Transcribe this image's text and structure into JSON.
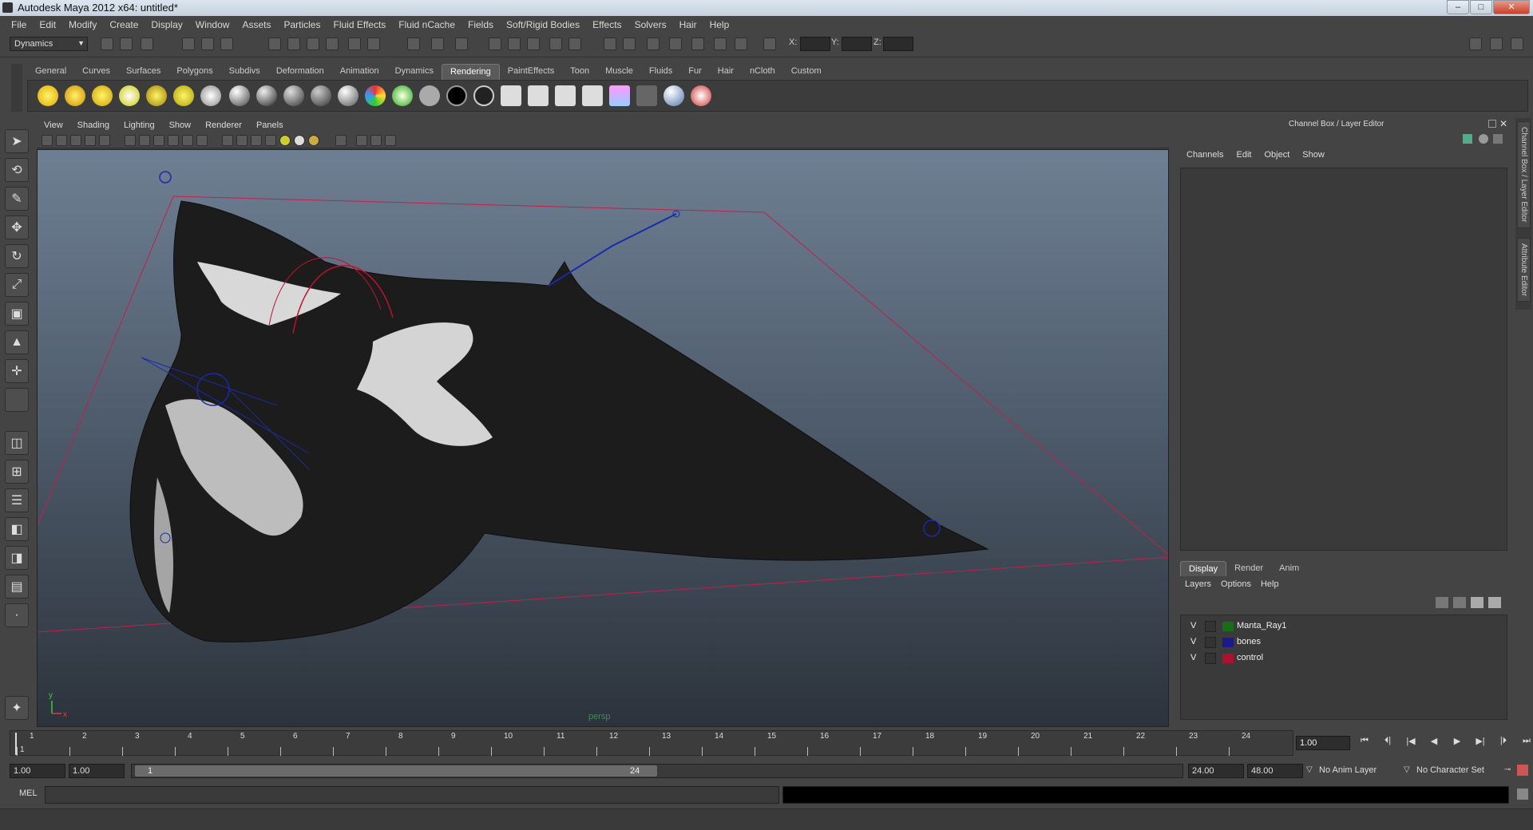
{
  "window": {
    "title": "Autodesk Maya 2012 x64: untitled*",
    "buttons": [
      "–",
      "□",
      "✕"
    ]
  },
  "menubar": [
    "File",
    "Edit",
    "Modify",
    "Create",
    "Display",
    "Window",
    "Assets",
    "Particles",
    "Fluid Effects",
    "Fluid nCache",
    "Fields",
    "Soft/Rigid Bodies",
    "Effects",
    "Solvers",
    "Hair",
    "Help"
  ],
  "statusline": {
    "mode": "Dynamics",
    "x_label": "X:",
    "y_label": "Y:",
    "z_label": "Z:"
  },
  "shelf_tabs": [
    "General",
    "Curves",
    "Surfaces",
    "Polygons",
    "Subdivs",
    "Deformation",
    "Animation",
    "Dynamics",
    "Rendering",
    "PaintEffects",
    "Toon",
    "Muscle",
    "Fluids",
    "Fur",
    "Hair",
    "nCloth",
    "Custom"
  ],
  "active_shelf_tab": "Rendering",
  "viewport": {
    "menus": [
      "View",
      "Shading",
      "Lighting",
      "Show",
      "Renderer",
      "Panels"
    ],
    "camera_label": "persp",
    "axis_y": "y",
    "axis_x": "x"
  },
  "channel_box": {
    "title": "Channel Box / Layer Editor",
    "menus": [
      "Channels",
      "Edit",
      "Object",
      "Show"
    ]
  },
  "side_tabs": [
    "Channel Box / Layer Editor",
    "Attribute Editor"
  ],
  "layer_editor": {
    "tabs": [
      "Display",
      "Render",
      "Anim"
    ],
    "active_tab": "Display",
    "menus": [
      "Layers",
      "Options",
      "Help"
    ],
    "layers": [
      {
        "visible": "V",
        "name": "Manta_Ray1",
        "color": "#1a6b1a"
      },
      {
        "visible": "V",
        "name": "bones",
        "color": "#1a1a8a"
      },
      {
        "visible": "V",
        "name": "control",
        "color": "#b01030"
      }
    ]
  },
  "time_slider": {
    "ticks": [
      "1",
      "2",
      "3",
      "4",
      "5",
      "6",
      "7",
      "8",
      "9",
      "10",
      "11",
      "12",
      "13",
      "14",
      "15",
      "16",
      "17",
      "18",
      "19",
      "20",
      "21",
      "22",
      "23",
      "24"
    ],
    "marker": "1",
    "current_frame": "1.00"
  },
  "range": {
    "start": "1.00",
    "inner_start": "1.00",
    "slider_start": "1",
    "slider_end": "24",
    "inner_end": "24.00",
    "end": "48.00",
    "anim_layer": "No Anim Layer",
    "char_set": "No Character Set"
  },
  "command_line": {
    "label": "MEL"
  },
  "colors": {
    "accent": "#5a5a5a",
    "bbox": "#c0204a",
    "joints": "#1a2aa8"
  }
}
